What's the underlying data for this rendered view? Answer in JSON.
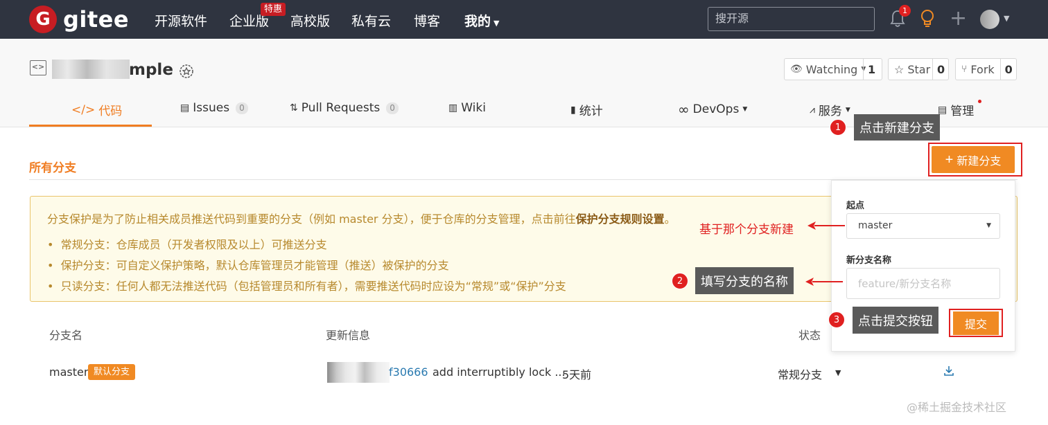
{
  "topnav": {
    "logo_letter": "G",
    "logo_text": "gitee",
    "items": [
      "开源软件",
      "企业版",
      "高校版",
      "私有云",
      "博客",
      "我的"
    ],
    "enterprise_badge": "特惠",
    "search_placeholder": "搜开源",
    "notification_count": "1"
  },
  "repo": {
    "name_suffix": "mple",
    "watching_label": "Watching",
    "watching_count": "1",
    "star_label": "Star",
    "star_count": "0",
    "fork_label": "Fork",
    "fork_count": "0"
  },
  "tabs": [
    {
      "label": "代码"
    },
    {
      "label": "Issues",
      "count": "0"
    },
    {
      "label": "Pull Requests",
      "count": "0"
    },
    {
      "label": "Wiki"
    },
    {
      "label": "统计"
    },
    {
      "label": "DevOps"
    },
    {
      "label": "服务"
    },
    {
      "label": "管理"
    }
  ],
  "branches": {
    "title": "所有分支",
    "new_button": "新建分支",
    "notice_intro": "分支保护是为了防止相关成员推送代码到重要的分支（例如 master 分支），便于仓库的分支管理，点击前往",
    "notice_link": "保护分支规则设置",
    "notice_end": "。",
    "notice_items": [
      "常规分支：仓库成员（开发者权限及以上）可推送分支",
      "保护分支：可自定义保护策略，默认仓库管理员才能管理（推送）被保护的分支",
      "只读分支：任何人都无法推送代码（包括管理员和所有者），需要推送代码时应设为“常规”或“保护”分支"
    ],
    "columns": {
      "name": "分支名",
      "update": "更新信息",
      "status": "状态"
    },
    "row": {
      "name": "master",
      "tag": "默认分支",
      "hash": "f30666",
      "message": "add interruptibly lock ...",
      "time": "5天前",
      "status": "常规分支"
    }
  },
  "popup": {
    "origin_label": "起点",
    "origin_value": "master",
    "new_name_label": "新分支名称",
    "new_name_placeholder": "feature/新分支名称",
    "submit": "提交"
  },
  "annotations": {
    "step1_num": "1",
    "step1": "点击新建分支",
    "step2_num": "2",
    "step2": "填写分支的名称",
    "step3_num": "3",
    "step3": "点击提交按钮",
    "origin_note": "基于那个分支新建"
  },
  "watermark": "@稀土掘金技术社区",
  "colors": {
    "accent": "#f07d22",
    "nav_bg": "#2f3440",
    "brand": "#c71d23",
    "annotation_red": "#e02020"
  }
}
